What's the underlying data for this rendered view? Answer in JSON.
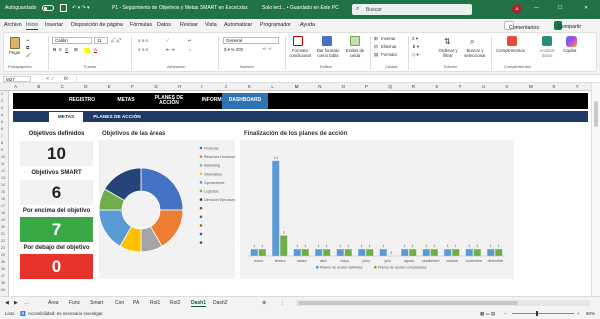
{
  "titlebar": {
    "autosave": "Autoguardado",
    "title": "P1 - Seguimiento de Objetivos y Metas SMART en Excel.xlsx",
    "status": "Solo lect... • Guardado en Este PC",
    "search_placeholder": "Buscar",
    "avatar_initials": "JL"
  },
  "menu": {
    "items": [
      "Archivo",
      "Inicio",
      "Insertar",
      "Disposición de página",
      "Fórmulas",
      "Datos",
      "Revisar",
      "Vista",
      "Automatizar",
      "Programador",
      "Ayuda"
    ],
    "comments_button": "Comentarios",
    "share_button": "Compartir"
  },
  "ribbon": {
    "paste": "Pegar",
    "clipboard_group": "Portapapeles",
    "font_name": "Calibri",
    "font_size": "11",
    "font_group": "Fuente",
    "alignment_group": "Alineación",
    "number_format": "General",
    "number_group": "Número",
    "conditional_format": "Formato condicional",
    "format_as_table": "Dar formato como tabla",
    "cell_styles": "Estilos de celda",
    "styles_group": "Estilos",
    "insert": "Insertar",
    "delete": "Eliminar",
    "format": "Formato",
    "cells_group": "Celdas",
    "sort_filter": "Ordenar y filtrar",
    "find_select": "Buscar y seleccionar",
    "editing_group": "Edición",
    "addins": "Complementos",
    "analyze_data": "Analizar datos",
    "copilot": "Copilot",
    "addins_group": "Complementos"
  },
  "formula_bar": {
    "name_box": "M27",
    "fx": "fx",
    "columns": [
      "A",
      "B",
      "C",
      "D",
      "E",
      "F",
      "G",
      "H",
      "I",
      "J",
      "K",
      "L",
      "M",
      "N",
      "O",
      "P",
      "Q",
      "R",
      "S",
      "T",
      "U",
      "V",
      "W",
      "X",
      "Y"
    ]
  },
  "dashboard": {
    "nav": [
      "REGISTRO",
      "METAS",
      "PLANES DE ACCIÓN",
      "INFORMES",
      "DASHBOARD"
    ],
    "active_nav": "DASHBOARD",
    "subtabs": [
      "METAS",
      "PLANES DE ACCIÓN"
    ],
    "active_subtab": "METAS",
    "kpis": [
      {
        "label": "Objetivos definidos",
        "value": "10",
        "color": "#f2f2f2",
        "text_color": "#222222"
      },
      {
        "label": "Objetivos SMART",
        "value": "6",
        "color": "#f2f2f2",
        "text_color": "#222222"
      },
      {
        "label": "Por encima del objetivo",
        "value": "7",
        "color": "#3aa845",
        "text_color": "#ffffff"
      },
      {
        "label": "Por debajo del objetivo",
        "value": "0",
        "color": "#e8332a",
        "text_color": "#ffffff"
      }
    ],
    "donut_title": "Objetivos de las áreas",
    "bar_title": "Finalización de los planes de acción"
  },
  "chart_data": [
    {
      "type": "pie",
      "title": "Objetivos de las áreas",
      "categories": [
        "Finanzas",
        "Recursos Humanos",
        "Marketing",
        "Informática",
        "Operaciones",
        "Logística",
        "Dirección Ejecutiva",
        "",
        "",
        "",
        "",
        ""
      ],
      "values": [
        3,
        2,
        1,
        1,
        2,
        1,
        2,
        0,
        0,
        0,
        0,
        0
      ],
      "colors": [
        "#4472c4",
        "#ed7d31",
        "#a5a5a5",
        "#ffc000",
        "#5b9bd5",
        "#70ad47",
        "#264478",
        "#9e480e",
        "#636363",
        "#997300",
        "#255e91",
        "#43682b"
      ],
      "legend": "right"
    },
    {
      "type": "bar",
      "title": "Finalización de los planes de acción",
      "categories": [
        "enero",
        "febrero",
        "marzo",
        "abril",
        "mayo",
        "junio",
        "julio",
        "agosto",
        "septiembre",
        "octubre",
        "noviembre",
        "diciembre"
      ],
      "series": [
        {
          "name": "Planes de acción definidos",
          "values": [
            1,
            14,
            1,
            1,
            1,
            1,
            1,
            1,
            1,
            1,
            1,
            1
          ],
          "color": "#5b9bd5"
        },
        {
          "name": "Planes de acción completados",
          "values": [
            1,
            3,
            1,
            1,
            1,
            1,
            0,
            1,
            1,
            1,
            1,
            1
          ],
          "color": "#70ad47"
        }
      ],
      "ylim": [
        0,
        15
      ],
      "legend": "bottom"
    }
  ],
  "sheet_tabs": [
    "Área",
    "Func",
    "Smart",
    "Con",
    "PA",
    "Rol1",
    "Rol2",
    "Dash1",
    "Dash2"
  ],
  "active_sheet": "Dash1",
  "statusbar": {
    "ready": "Listo",
    "accessibility": "Accesibilidad: es necesario investigar",
    "zoom": "80%"
  }
}
